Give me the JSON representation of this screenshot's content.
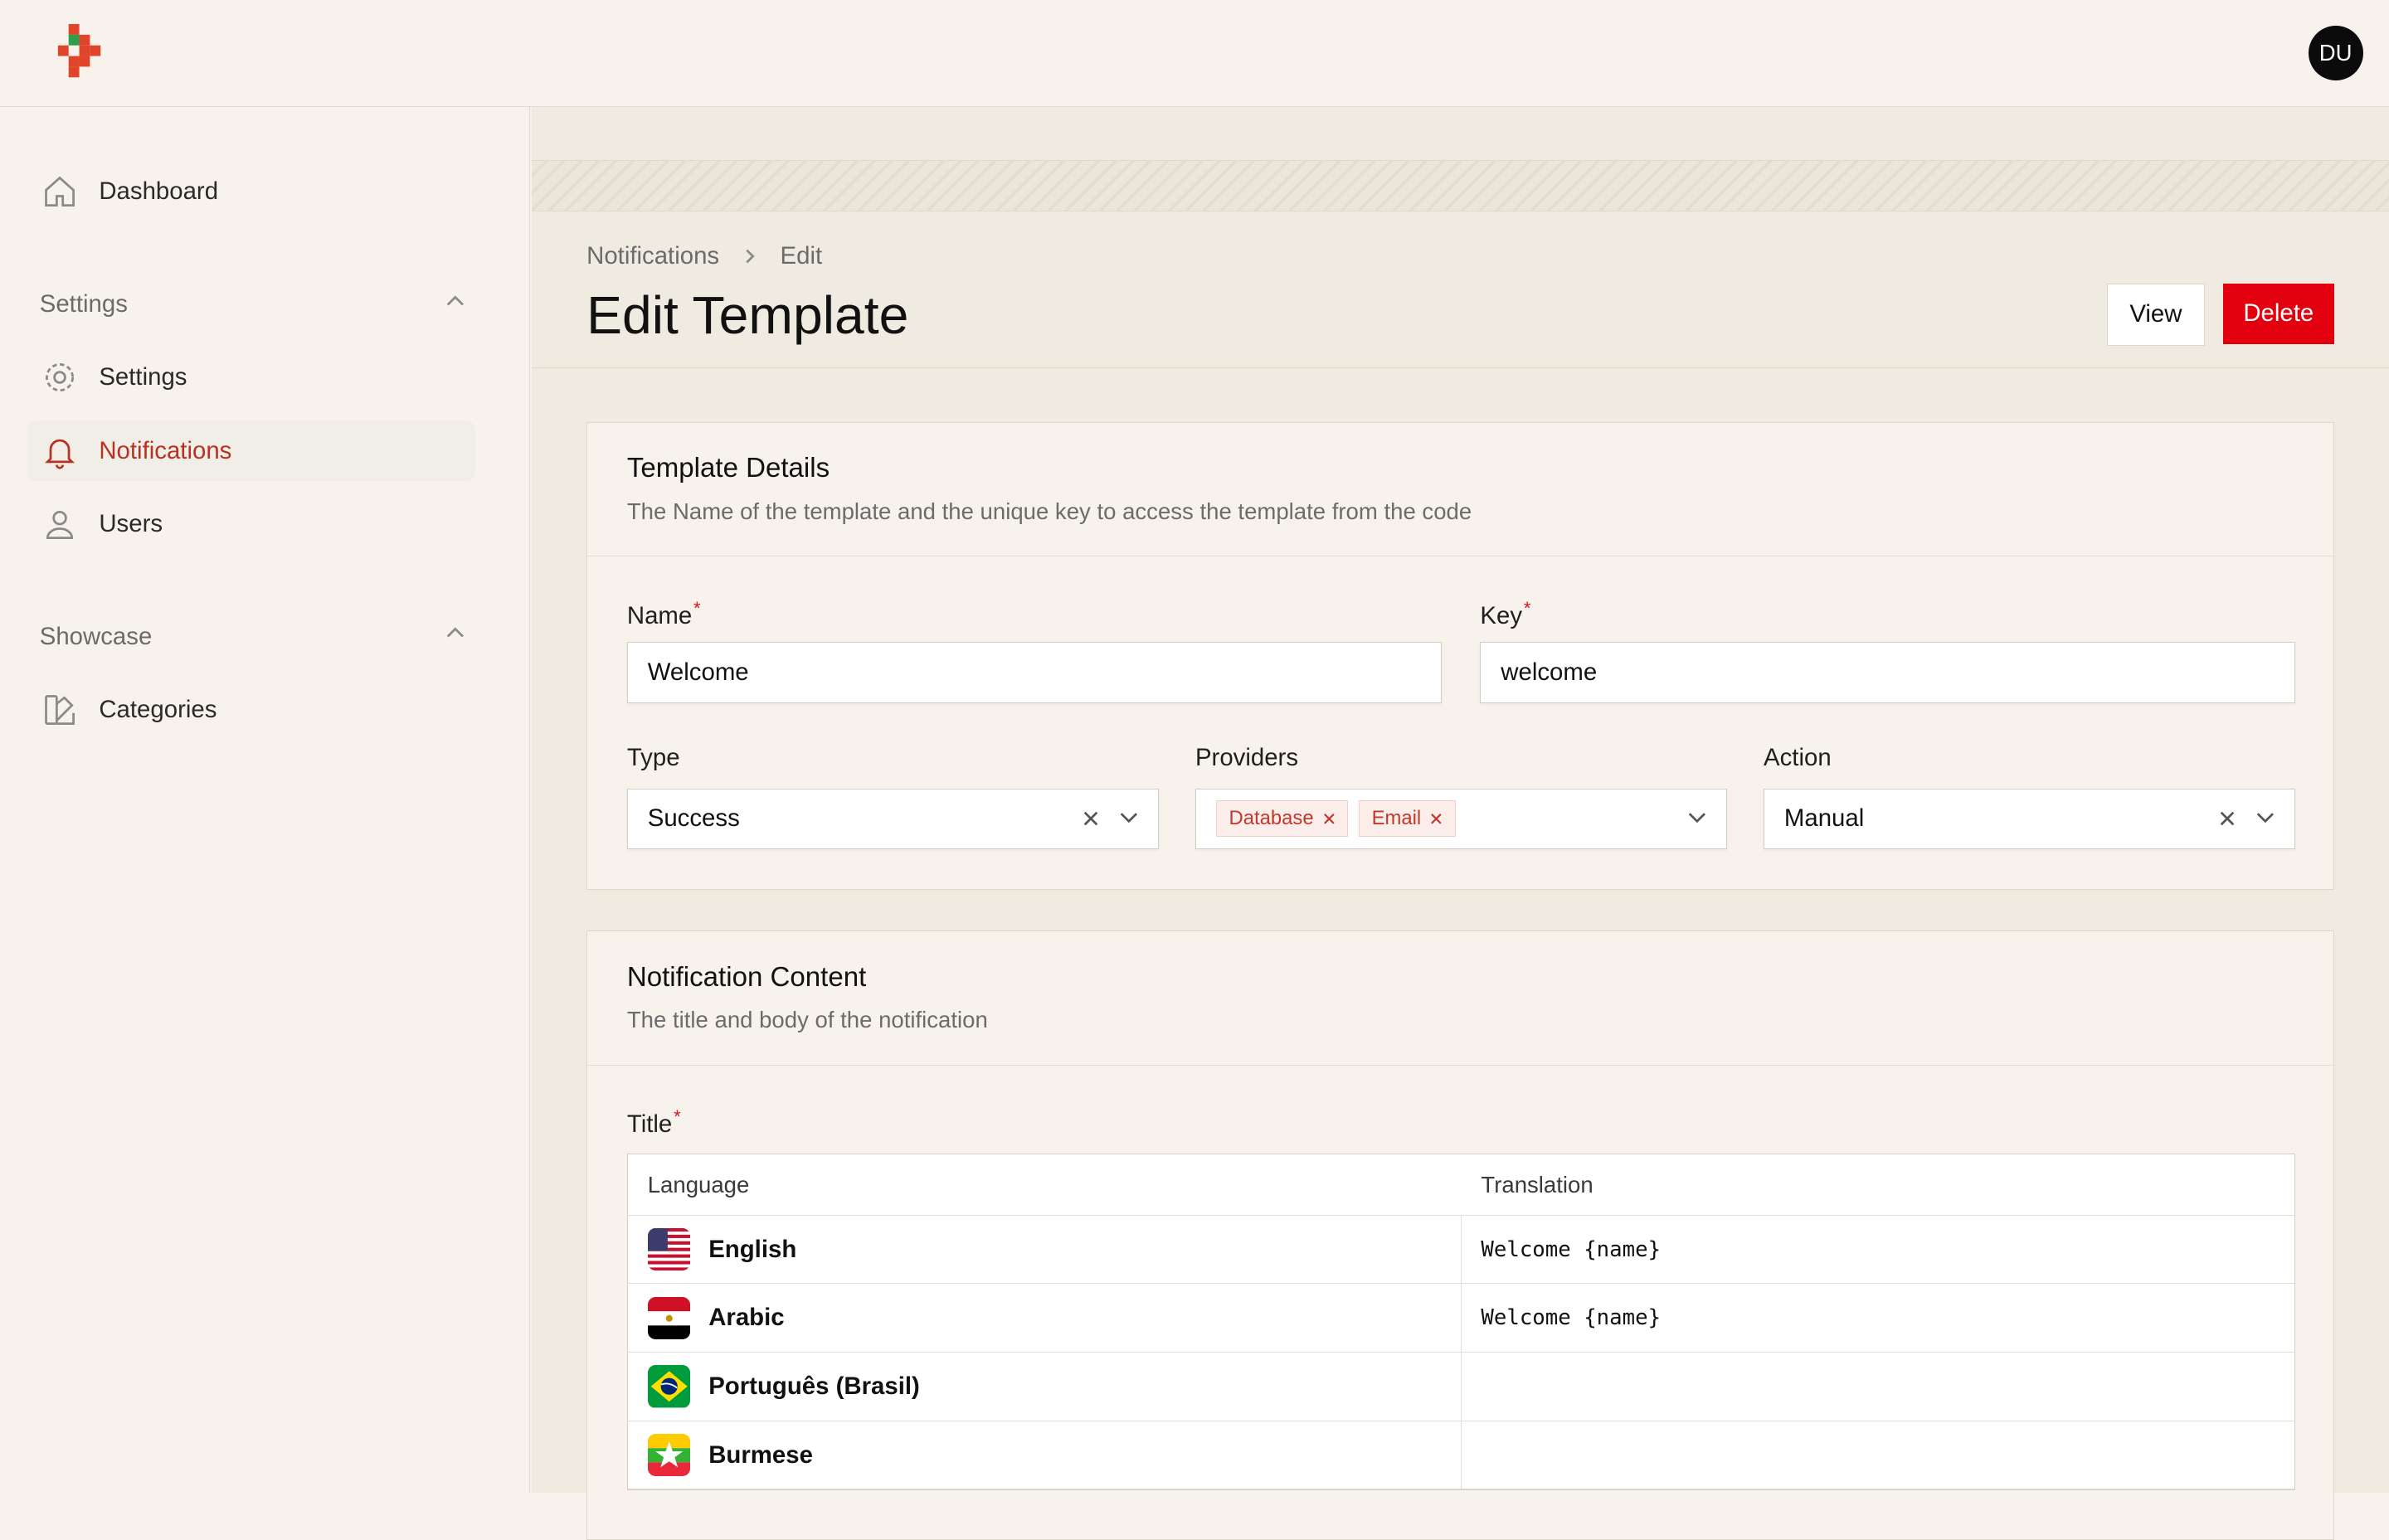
{
  "topbar": {
    "avatar_initials": "DU"
  },
  "sidebar": {
    "dashboard_label": "Dashboard",
    "groups": [
      {
        "label": "Settings",
        "items": [
          {
            "label": "Settings",
            "icon": "gear-icon"
          },
          {
            "label": "Notifications",
            "icon": "bell-icon",
            "active": true
          },
          {
            "label": "Users",
            "icon": "user-icon"
          }
        ]
      },
      {
        "label": "Showcase",
        "items": [
          {
            "label": "Categories",
            "icon": "swatch-icon"
          }
        ]
      }
    ]
  },
  "breadcrumb": {
    "parent": "Notifications",
    "current": "Edit"
  },
  "page": {
    "title": "Edit Template"
  },
  "actions": {
    "view_label": "View",
    "delete_label": "Delete"
  },
  "colors": {
    "accent": "#b83222",
    "danger": "#e2000f",
    "required": "#d6141e"
  },
  "template_details": {
    "title": "Template Details",
    "description": "The Name of the template and the unique key to access the template from the code",
    "name_label": "Name",
    "name_value": "Welcome",
    "key_label": "Key",
    "key_value": "welcome",
    "type_label": "Type",
    "type_value": "Success",
    "providers_label": "Providers",
    "providers": [
      "Database",
      "Email"
    ],
    "action_label": "Action",
    "action_value": "Manual"
  },
  "notification_content": {
    "title": "Notification Content",
    "description": "The title and body of the notification",
    "title_label": "Title",
    "table": {
      "headers": [
        "Language",
        "Translation"
      ],
      "rows": [
        {
          "language": "English",
          "flag": "us-flag-icon",
          "translation": "Welcome {name}"
        },
        {
          "language": "Arabic",
          "flag": "egypt-flag-icon",
          "translation": "Welcome {name}"
        },
        {
          "language": "Português (Brasil)",
          "flag": "brazil-flag-icon",
          "translation": ""
        },
        {
          "language": "Burmese",
          "flag": "myanmar-flag-icon",
          "translation": ""
        }
      ]
    }
  }
}
